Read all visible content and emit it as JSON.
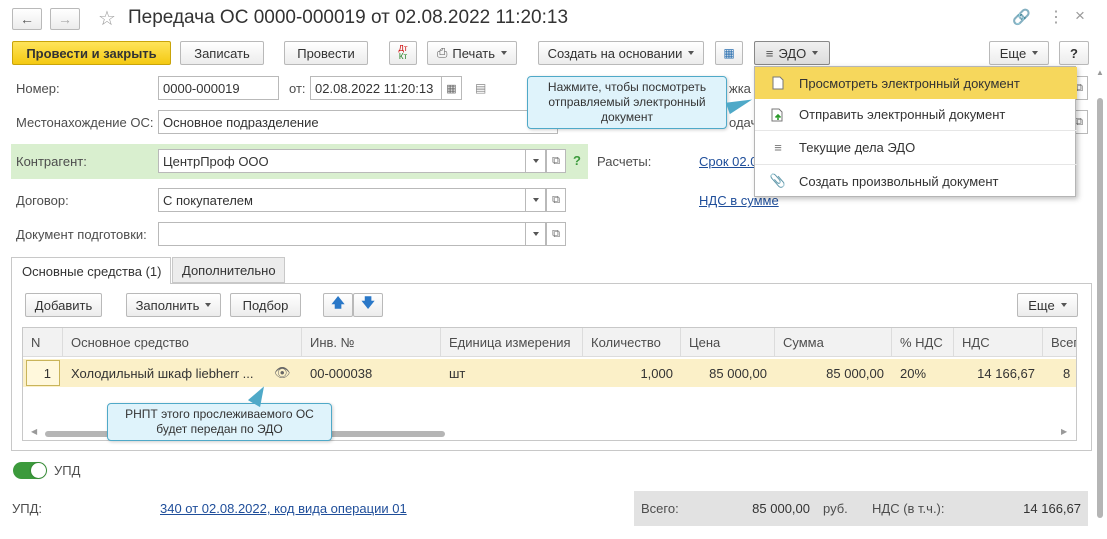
{
  "header": {
    "title": "Передача ОС 0000-000019 от 02.08.2022 11:20:13"
  },
  "toolbar": {
    "post_close": "Провести и закрыть",
    "save": "Записать",
    "post": "Провести",
    "dt_kt": "Дт",
    "kt": "Кт",
    "print": "Печать",
    "create_based": "Создать на основании",
    "edo": "ЭДО",
    "more": "Еще",
    "help": "?"
  },
  "form": {
    "number_label": "Номер:",
    "number_value": "0000-000019",
    "date_label": "от:",
    "date_value": "02.08.2022 11:20:13",
    "location_label": "Местонахождение ОС:",
    "location_value": "Основное подразделение",
    "counterparty_label": "Контрагент:",
    "counterparty_value": "ЦентрПроф ООО",
    "contract_label": "Договор:",
    "contract_value": "С покупателем",
    "prep_doc_label": "Документ подготовки:",
    "prep_doc_value": "",
    "settlements_label": "Расчеты:",
    "settlements_link": "Срок 02.0",
    "vat_link": "НДС в сумме",
    "right_partial_1": "жка",
    "right_partial_2": "одач"
  },
  "tooltips": {
    "edo_hint": "Нажмите, чтобы посмотреть отправляемый электронный документ",
    "rnpt_hint": "РНПТ этого прослеживаемого ОС будет передан по ЭДО"
  },
  "edo_menu": {
    "items": [
      {
        "label": "Просмотреть электронный документ",
        "icon": "document-icon"
      },
      {
        "label": "Отправить электронный документ",
        "icon": "send-document-icon"
      },
      {
        "label": "Текущие дела ЭДО",
        "icon": "edo-tasks-icon"
      },
      {
        "label": "Создать произвольный документ",
        "icon": "paperclip-icon"
      }
    ]
  },
  "tabs": [
    {
      "label": "Основные средства (1)"
    },
    {
      "label": "Дополнительно"
    }
  ],
  "table_toolbar": {
    "add": "Добавить",
    "fill": "Заполнить",
    "select": "Подбор",
    "more": "Еще"
  },
  "table": {
    "columns": [
      "N",
      "Основное средство",
      "Инв. №",
      "Единица измерения",
      "Количество",
      "Цена",
      "Сумма",
      "% НДС",
      "НДС",
      "Всег"
    ],
    "rows": [
      {
        "n": "1",
        "asset": "Холодильный шкаф liebherr ...",
        "inv": "00-000038",
        "unit": "шт",
        "qty": "1,000",
        "price": "85 000,00",
        "sum": "85 000,00",
        "vat_rate": "20%",
        "vat": "14 166,67",
        "total": "8"
      }
    ]
  },
  "footer": {
    "upd_toggle_label": "УПД",
    "upd_label": "УПД:",
    "upd_link": "340 от 02.08.2022, код вида операции 01",
    "total_label": "Всего:",
    "total_value": "85 000,00",
    "currency": "руб.",
    "vat_label": "НДС (в т.ч.):",
    "vat_value": "14 166,67"
  },
  "colors": {
    "primary_button": "#f4c912",
    "highlight_row": "#fbf0c8",
    "counterparty_bg": "#d9efcf",
    "link": "#1f4e9a",
    "toggle_on": "#3c9a3c",
    "tooltip_bg": "#dff3fb"
  }
}
